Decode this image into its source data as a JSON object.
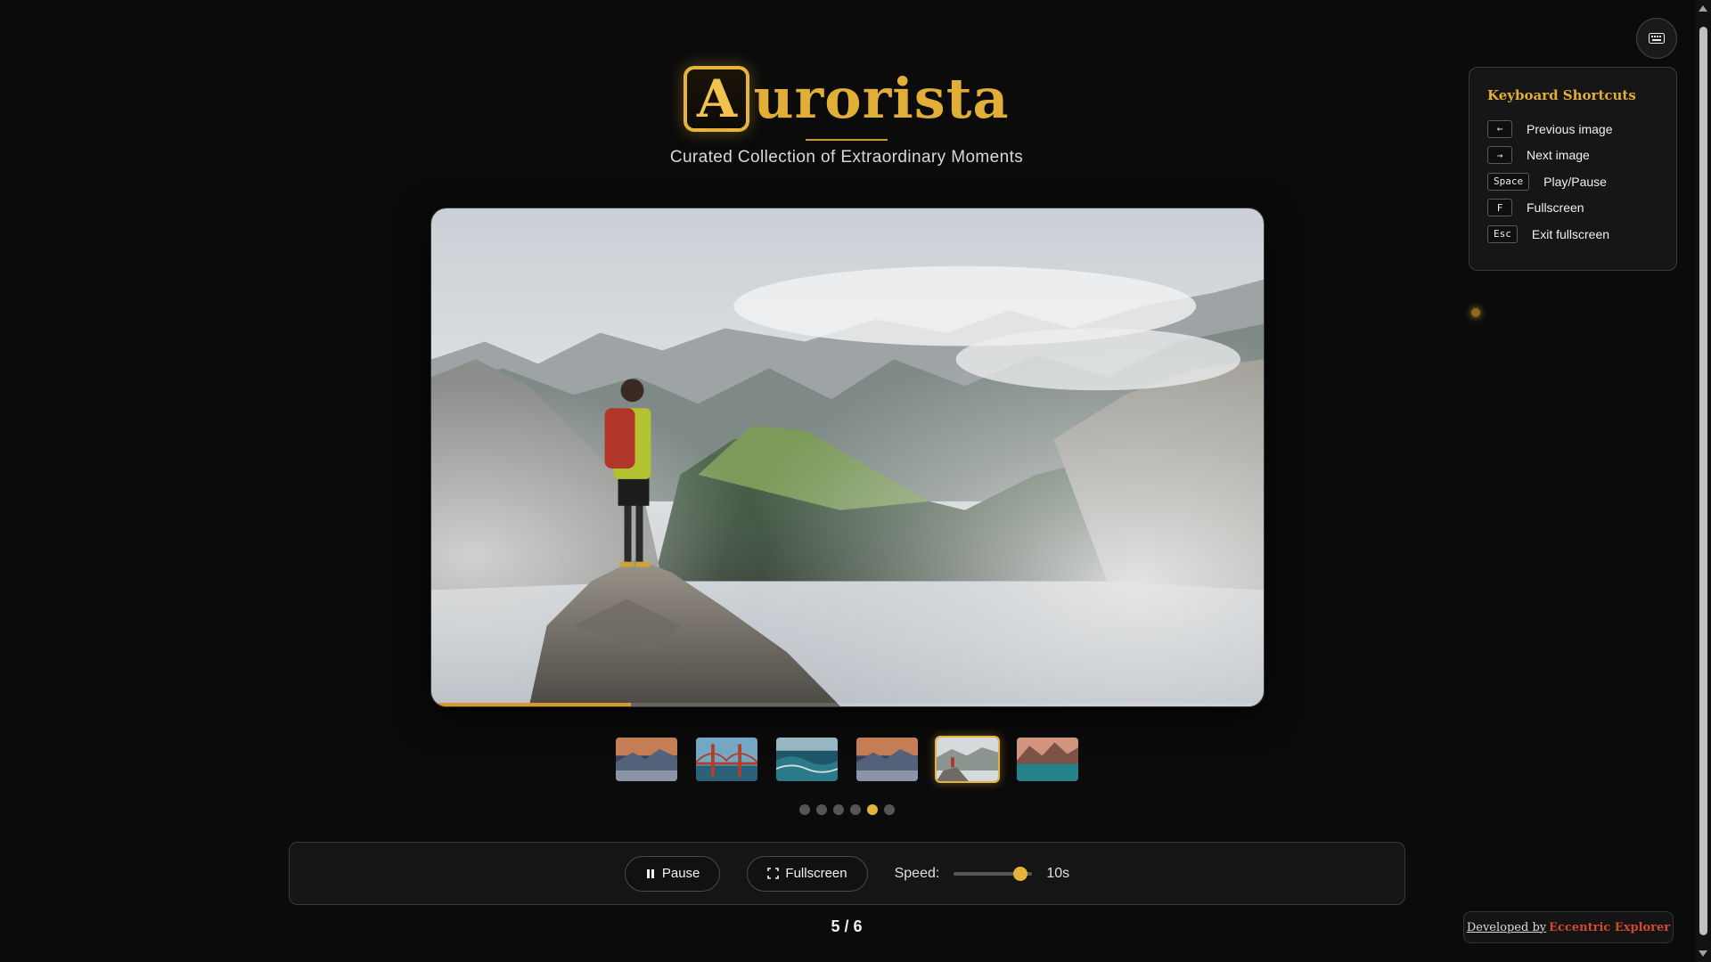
{
  "brand": {
    "logo_letter": "A",
    "logo_rest": "urorista",
    "tagline": "Curated Collection of Extraordinary Moments",
    "accent_color": "#e6b43c"
  },
  "slideshow": {
    "current_index": 5,
    "total": 6,
    "counter_text": "5 / 6",
    "progress_fraction": 0.24,
    "main_image_icon": "hiker-on-mountain-cliff-photo",
    "thumbnails": [
      {
        "icon": "mountain-sunset-thumbnail"
      },
      {
        "icon": "golden-gate-bridge-thumbnail"
      },
      {
        "icon": "ocean-waves-thumbnail"
      },
      {
        "icon": "mountain-sunset-thumbnail"
      },
      {
        "icon": "hiker-mountain-thumbnail"
      },
      {
        "icon": "mountain-lake-thumbnail"
      }
    ]
  },
  "controls": {
    "pause_label": "Pause",
    "fullscreen_label": "Fullscreen",
    "speed_label": "Speed:",
    "speed_value": "10s",
    "speed_fraction": 0.85
  },
  "shortcuts": {
    "title": "Keyboard Shortcuts",
    "items": [
      {
        "key": "←",
        "action": "Previous image"
      },
      {
        "key": "→",
        "action": "Next image"
      },
      {
        "key": "Space",
        "action": "Play/Pause"
      },
      {
        "key": "F",
        "action": "Fullscreen"
      },
      {
        "key": "Esc",
        "action": "Exit fullscreen"
      }
    ]
  },
  "credit": {
    "prefix": "Developed by",
    "name": "Eccentric Explorer"
  }
}
